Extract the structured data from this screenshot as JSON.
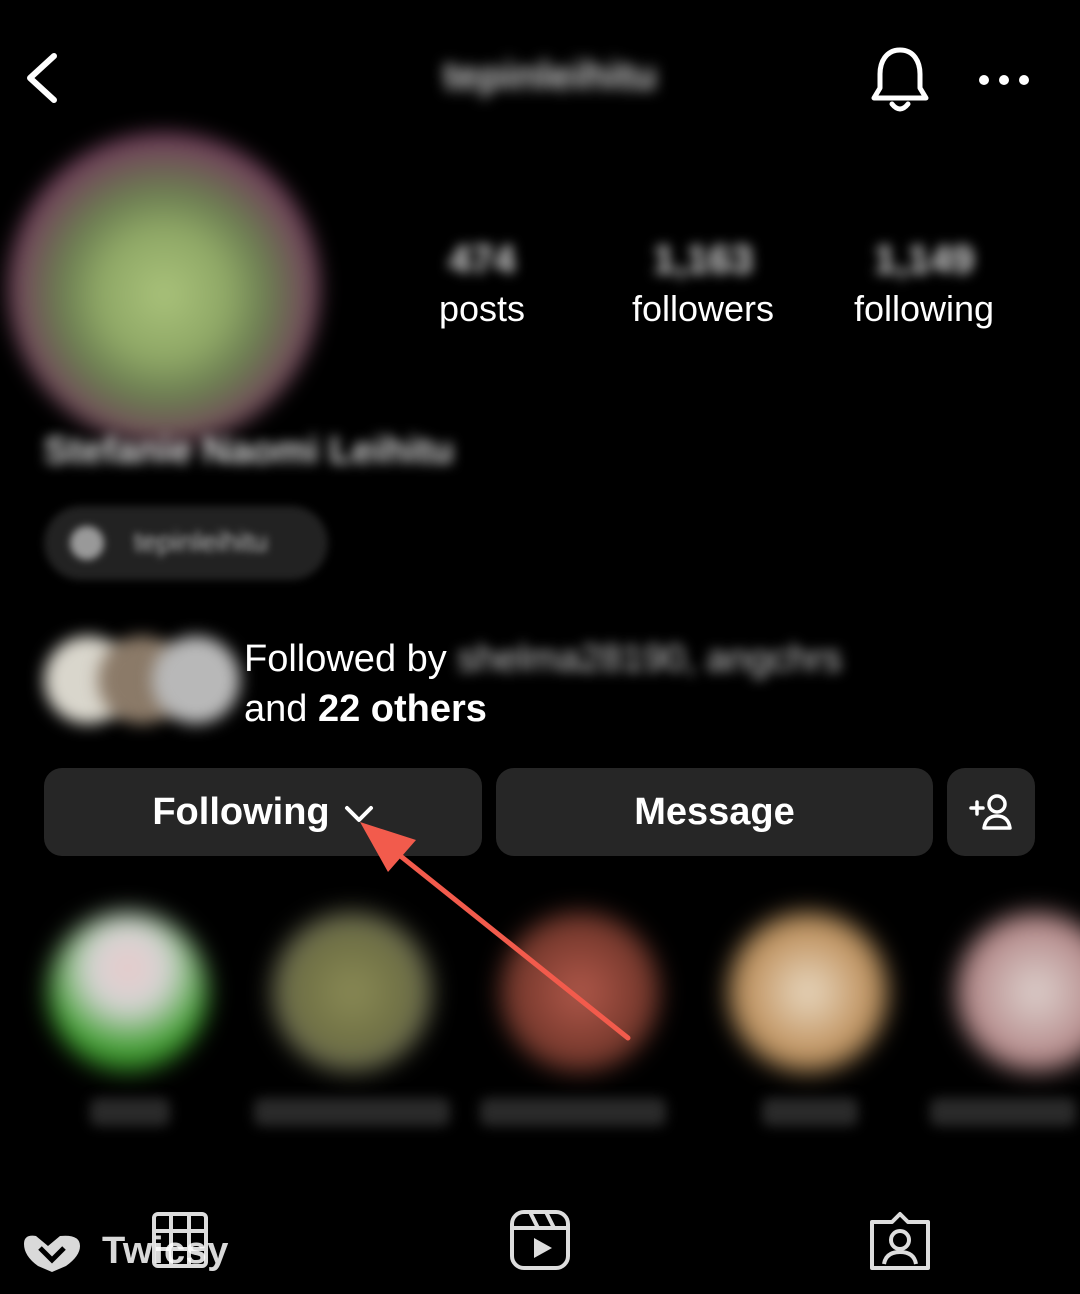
{
  "header": {
    "username": "tepinleihitu"
  },
  "profile": {
    "full_name": "Stefanie Naomi Leihitu",
    "handle": "tepinleihitu",
    "stats": [
      {
        "value": "474",
        "label": "posts"
      },
      {
        "value": "1,163",
        "label": "followers"
      },
      {
        "value": "1,149",
        "label": "following"
      }
    ]
  },
  "mutuals": {
    "prefix": "Followed by",
    "names": "shelma28190, angchrs",
    "and_word": "and",
    "others": "22 others"
  },
  "actions": {
    "following_label": "Following",
    "message_label": "Message"
  },
  "watermark": {
    "text": "Twicsy"
  },
  "colors": {
    "background": "#000000",
    "button": "#262626",
    "annotation_arrow": "#f25b4c"
  },
  "icons": {
    "back": "chevron-left-icon",
    "bell": "bell-icon",
    "more": "more-horizontal-icon",
    "add_user": "add-user-icon",
    "grid": "grid-icon",
    "reels": "reels-icon",
    "tagged": "tagged-icon"
  }
}
